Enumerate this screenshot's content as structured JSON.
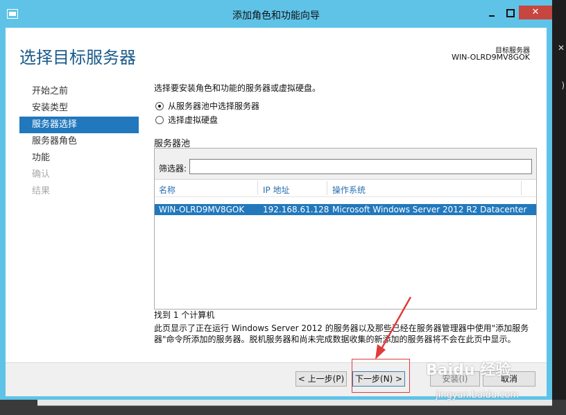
{
  "window": {
    "title": "添加角色和功能向导"
  },
  "header": {
    "title": "选择目标服务器",
    "target_label": "目标服务器",
    "target_name": "WIN-OLRD9MV8GOK"
  },
  "nav": {
    "items": [
      {
        "label": "开始之前",
        "state": "normal"
      },
      {
        "label": "安装类型",
        "state": "normal"
      },
      {
        "label": "服务器选择",
        "state": "active"
      },
      {
        "label": "服务器角色",
        "state": "normal"
      },
      {
        "label": "功能",
        "state": "normal"
      },
      {
        "label": "确认",
        "state": "disabled"
      },
      {
        "label": "结果",
        "state": "disabled"
      }
    ]
  },
  "main": {
    "intro": "选择要安装角色和功能的服务器或虚拟硬盘。",
    "options": [
      {
        "label": "从服务器池中选择服务器",
        "selected": true
      },
      {
        "label": "选择虚拟硬盘",
        "selected": false
      }
    ],
    "pool_label": "服务器池",
    "filter_label": "筛选器:",
    "filter_value": "",
    "columns": [
      "名称",
      "IP 地址",
      "操作系统"
    ],
    "rows": [
      {
        "name": "WIN-OLRD9MV8GOK",
        "ip": "192.168.61.128",
        "os": "Microsoft Windows Server 2012 R2 Datacenter"
      }
    ],
    "found": "找到 1 个计算机",
    "description": "此页显示了正在运行 Windows Server 2012 的服务器以及那些已经在服务器管理器中使用\"添加服务器\"命令所添加的服务器。脱机服务器和尚未完成数据收集的新添加的服务器将不会在此页中显示。"
  },
  "footer": {
    "prev": "< 上一步(P)",
    "next": "下一步(N) >",
    "install": "安装(I)",
    "cancel": "取消"
  },
  "watermark": {
    "text": "Baidu 经验",
    "sub": "jingyan.baidu.com"
  },
  "colors": {
    "titlebar": "#5fc3e8",
    "accent": "#2178bd",
    "close": "#c7463f",
    "highlight": "#e03b3b"
  }
}
